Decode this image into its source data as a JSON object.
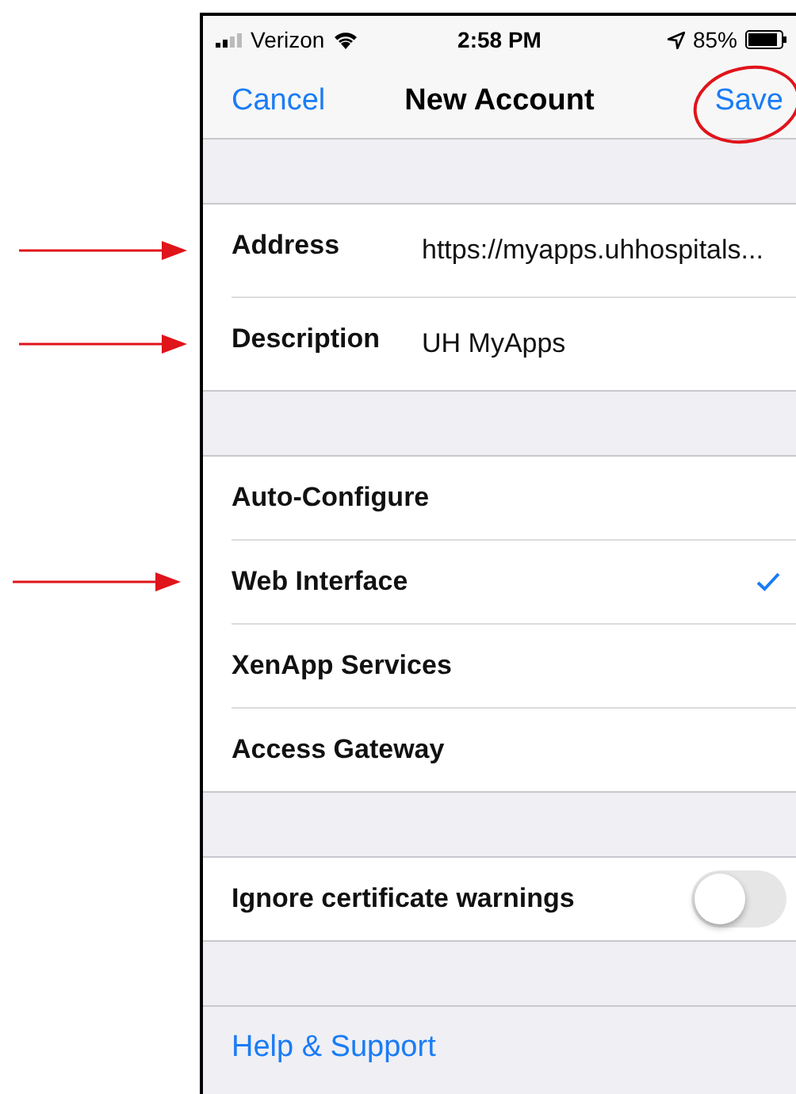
{
  "status_bar": {
    "carrier": "Verizon",
    "time": "2:58 PM",
    "battery": "85%"
  },
  "nav": {
    "cancel": "Cancel",
    "title": "New Account",
    "save": "Save",
    "save_circled": true
  },
  "fields": [
    {
      "label": "Address",
      "value": "https://myapps.uhhospitals...",
      "annotated": true
    },
    {
      "label": "Description",
      "value": "UH MyApps",
      "annotated": true
    }
  ],
  "options": [
    {
      "label": "Auto-Configure",
      "selected": false,
      "annotated": false
    },
    {
      "label": "Web Interface",
      "selected": true,
      "annotated": true
    },
    {
      "label": "XenApp Services",
      "selected": false,
      "annotated": false
    },
    {
      "label": "Access Gateway",
      "selected": false,
      "annotated": false
    }
  ],
  "toggle": {
    "label": "Ignore certificate warnings",
    "on": false
  },
  "help_link": "Help & Support"
}
